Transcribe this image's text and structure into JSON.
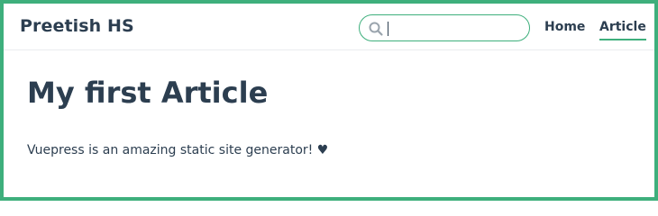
{
  "navbar": {
    "site_name": "Preetish HS",
    "search": {
      "value": "",
      "placeholder": ""
    },
    "links": [
      {
        "label": "Home",
        "active": false
      },
      {
        "label": "Article",
        "active": true
      }
    ]
  },
  "page": {
    "title": "My first Article",
    "body_text": "Vuepress is an amazing static site generator! ♥"
  },
  "colors": {
    "accent": "#3eaf7c",
    "text": "#2c3e50",
    "border": "#eaecef"
  },
  "icons": {
    "search": "search-icon"
  }
}
